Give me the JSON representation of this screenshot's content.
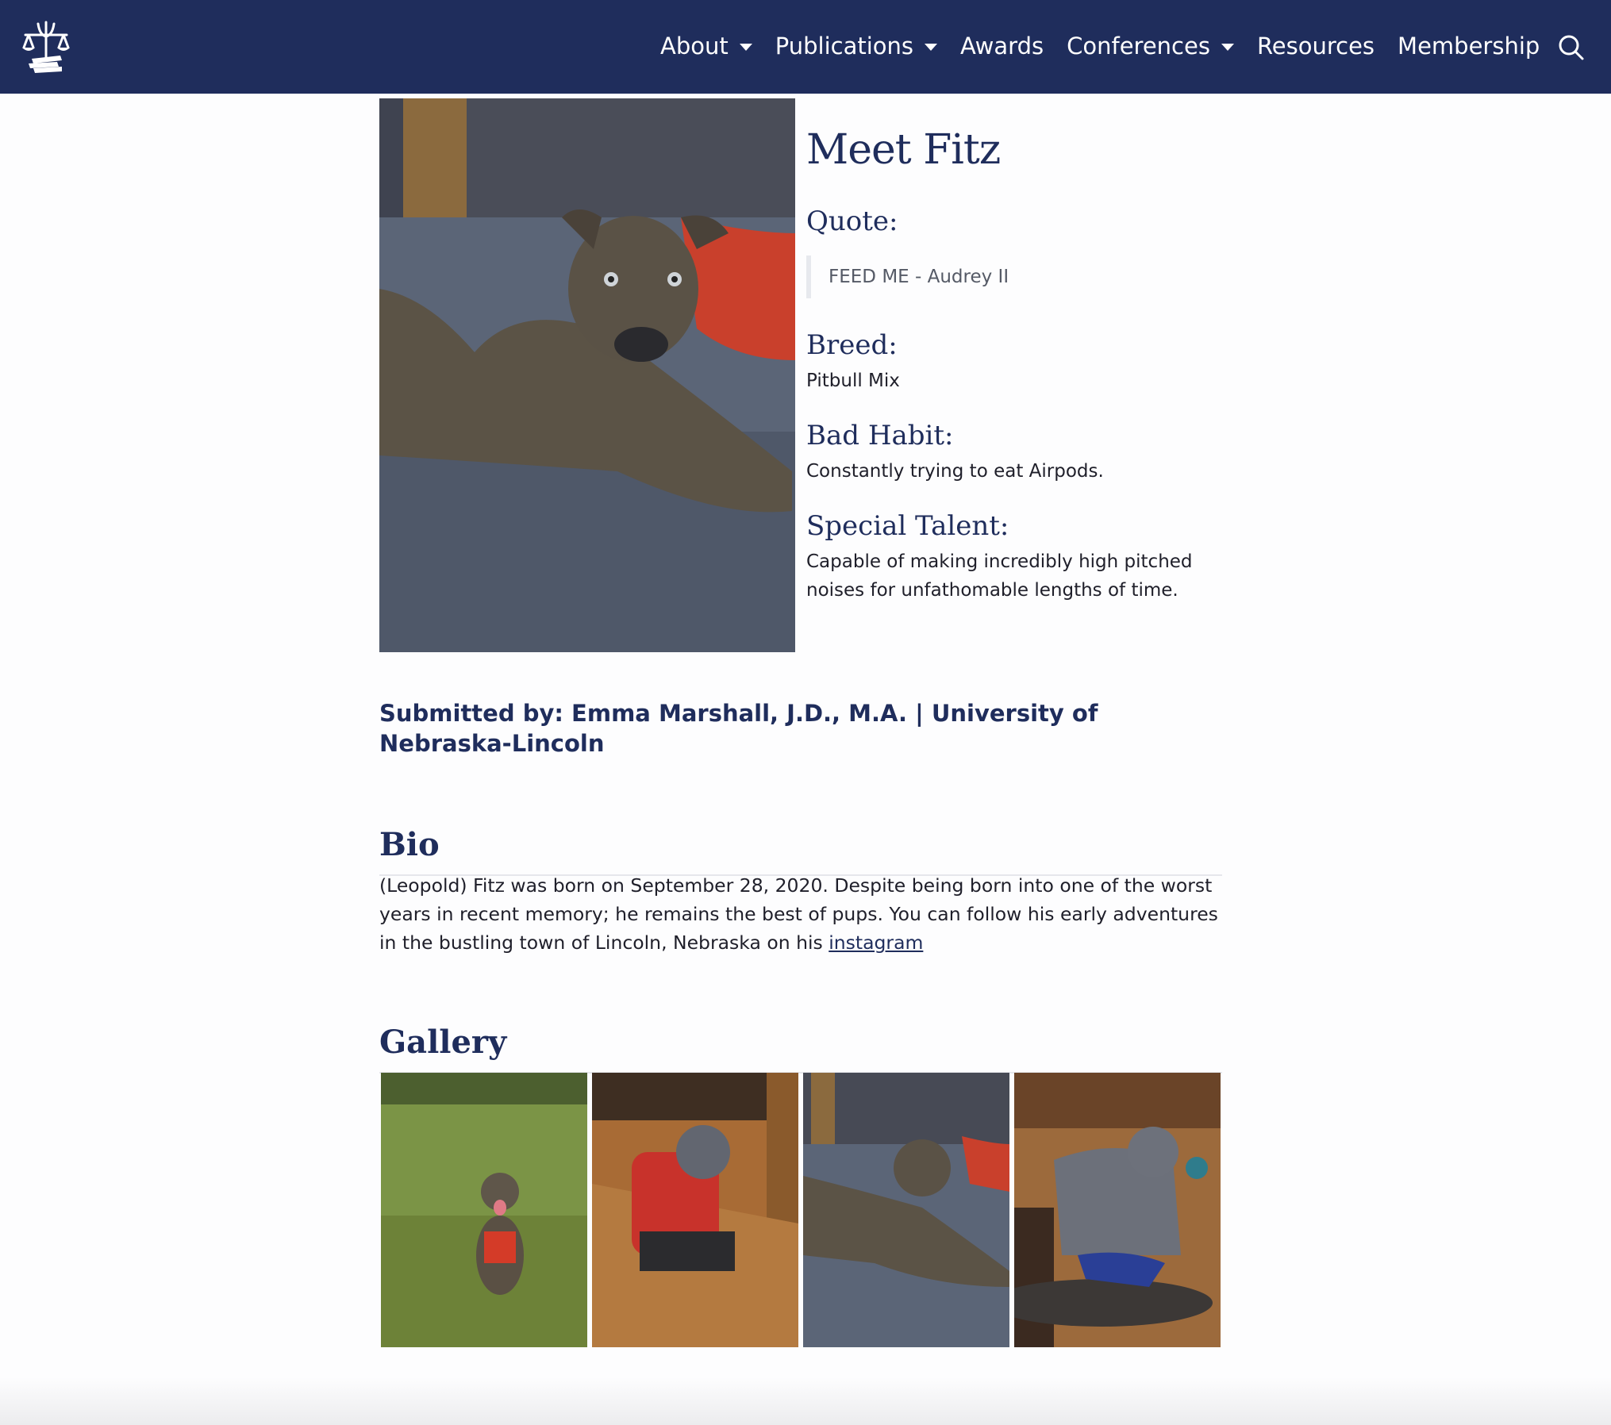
{
  "nav": {
    "items": [
      {
        "label": "About",
        "dropdown": true
      },
      {
        "label": "Publications",
        "dropdown": true
      },
      {
        "label": "Awards",
        "dropdown": false
      },
      {
        "label": "Conferences",
        "dropdown": true
      },
      {
        "label": "Resources",
        "dropdown": false
      },
      {
        "label": "Membership",
        "dropdown": false
      }
    ],
    "logo_icon": "scales-of-justice-books-logo",
    "search_icon": "search-icon"
  },
  "profile": {
    "title": "Meet Fitz",
    "quote_label": "Quote:",
    "quote_text": "FEED ME - Audrey II",
    "breed_label": "Breed:",
    "breed_value": "Pitbull Mix",
    "habit_label": "Bad Habit:",
    "habit_value": "Constantly trying to eat Airpods.",
    "talent_label": "Special Talent:",
    "talent_value": "Capable of making incredibly high pitched noises for unfathomable lengths of time."
  },
  "submitted": "Submitted by: Emma Marshall, J.D., M.A. | University of Nebraska-Lincoln",
  "bio": {
    "heading": "Bio",
    "text": "(Leopold) Fitz was born on September 28, 2020. Despite being born into one of the worst years in recent memory; he remains the best of pups. You can follow his early adventures in the bustling town of Lincoln, Nebraska on his ",
    "link": "instagram"
  },
  "gallery": {
    "heading": "Gallery"
  },
  "colors": {
    "navy": "#1f2d5c",
    "text": "#1f1f2a",
    "quote_text": "#555a66",
    "divider": "#e6e7ec"
  }
}
